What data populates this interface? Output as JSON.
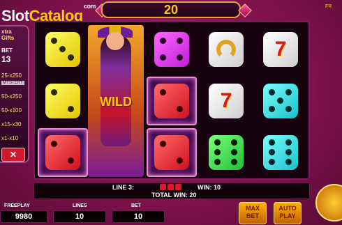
{
  "logo": {
    "a": "Slot",
    "b": "Catalog",
    "c": "com"
  },
  "top": {
    "win": "20",
    "corner": "FR"
  },
  "panel": {
    "title1": "xtra",
    "title2": "Gifts",
    "bet_label": "BET",
    "bet_value": "13",
    "rows": [
      "25-x250",
      "MYSTERY",
      "50-x250",
      "50-x100",
      "x15-x30",
      "x1-x10"
    ],
    "close": "✕"
  },
  "reels": {
    "col1": [
      "dice-yellow-3",
      "dice-yellow-2",
      "dice-red-2"
    ],
    "col3": [
      "dice-magenta-4",
      "dice-red-2",
      "dice-red-2"
    ],
    "col4": [
      "horseshoe",
      "seven",
      "dice-green-6"
    ],
    "col5": [
      "seven",
      "dice-cyan-5",
      "dice-cyan-6"
    ],
    "wild_text": "WILD"
  },
  "info": {
    "line": "LINE 3:",
    "win": "WIN: 10",
    "total": "TOTAL WIN: 20"
  },
  "bottom": {
    "freeplay_label": "FREEPLAY",
    "freeplay": "9980",
    "lines_label": "LINES",
    "lines": "10",
    "bet_label": "BET",
    "bet": "10",
    "maxbet": [
      "MAX",
      "BET"
    ],
    "autoplay": [
      "AUTO",
      "PLAY"
    ]
  },
  "colors": {
    "accent": "#ffc61a",
    "highlight": "#e98fd6"
  }
}
